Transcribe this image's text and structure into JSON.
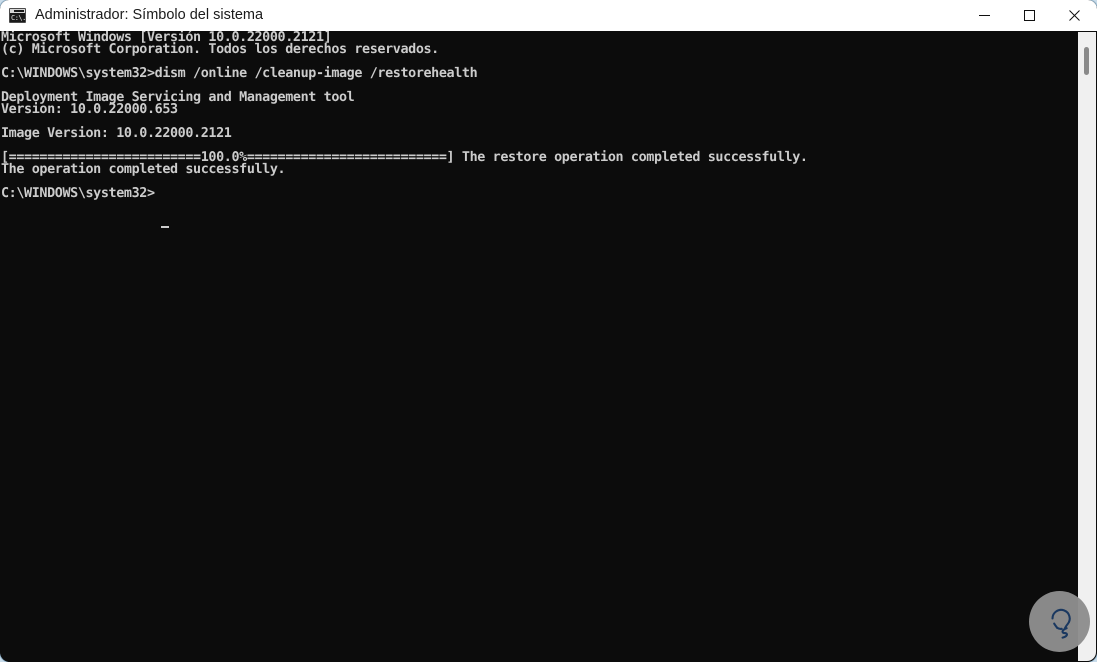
{
  "window": {
    "title": "Administrador: Símbolo del sistema",
    "icon_name": "cmd-icon",
    "icon_glyph": "C:\\.",
    "controls": {
      "minimize_label": "Minimizar",
      "maximize_label": "Maximizar",
      "close_label": "Cerrar"
    },
    "titlebar_bg": "#ffffff",
    "titlebar_fg": "#1b1b1b"
  },
  "console": {
    "background": "#0c0c0c",
    "foreground": "#cccccc",
    "lines": [
      "Microsoft Windows [Versión 10.0.22000.2121]",
      "(c) Microsoft Corporation. Todos los derechos reservados.",
      "",
      "C:\\WINDOWS\\system32>dism /online /cleanup-image /restorehealth",
      "",
      "Deployment Image Servicing and Management tool",
      "Version: 10.0.22000.653",
      "",
      "Image Version: 10.0.22000.2121",
      "",
      "[=========================100.0%==========================] The restore operation completed successfully.",
      "The operation completed successfully.",
      "",
      "C:\\WINDOWS\\system32>"
    ],
    "text": "Microsoft Windows [Versión 10.0.22000.2121]\n(c) Microsoft Corporation. Todos los derechos reservados.\n\nC:\\WINDOWS\\system32>dism /online /cleanup-image /restorehealth\n\nDeployment Image Servicing and Management tool\nVersion: 10.0.22000.653\n\nImage Version: 10.0.22000.2121\n\n[=========================100.0%==========================] The restore operation completed successfully.\nThe operation completed successfully.\n\nC:\\WINDOWS\\system32>",
    "prompt": "C:\\WINDOWS\\system32>",
    "command": "dism /online /cleanup-image /restorehealth",
    "progress_percent": "100.0%",
    "status_message": "The restore operation completed successfully.",
    "final_message": "The operation completed successfully."
  },
  "scrollbar": {
    "name": "vertical-scrollbar",
    "track_color": "#f0f0f0",
    "thumb_color": "#8a8a8a"
  },
  "watermark": {
    "name": "solvetic-lightbulb-logo",
    "circle_color": "#8e8e8e",
    "glyph_color": "#1b3a63"
  }
}
